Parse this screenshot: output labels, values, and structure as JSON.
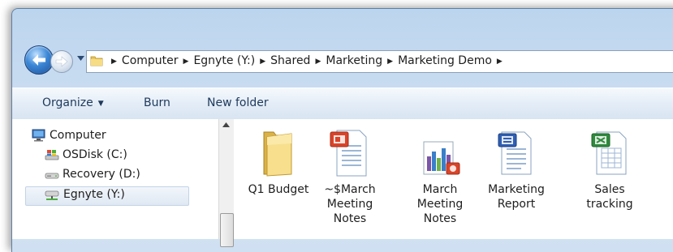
{
  "address": {
    "crumbs": [
      "Computer",
      "Egnyte (Y:)",
      "Shared",
      "Marketing",
      "Marketing Demo"
    ]
  },
  "toolbar": {
    "organize_label": "Organize",
    "burn_label": "Burn",
    "new_folder_label": "New folder"
  },
  "nav": {
    "items": [
      {
        "label": "Computer",
        "icon": "computer-icon"
      },
      {
        "label": "OSDisk (C:)",
        "icon": "windows-drive-icon"
      },
      {
        "label": "Recovery (D:)",
        "icon": "drive-icon"
      },
      {
        "label": "Egnyte (Y:)",
        "icon": "network-drive-icon",
        "selected": true
      }
    ]
  },
  "files": [
    {
      "name": "Q1 Budget",
      "icon": "folder-icon"
    },
    {
      "name": "~$March Meeting Notes",
      "icon": "powerpoint-file-icon"
    },
    {
      "name": "March Meeting Notes",
      "icon": "powerpoint-chart-file-icon"
    },
    {
      "name": "Marketing Report",
      "icon": "word-file-icon"
    },
    {
      "name": "Sales tracking",
      "icon": "excel-file-icon"
    }
  ],
  "colors": {
    "accent": "#3a86d6",
    "toolbar_text": "#1e395b"
  }
}
